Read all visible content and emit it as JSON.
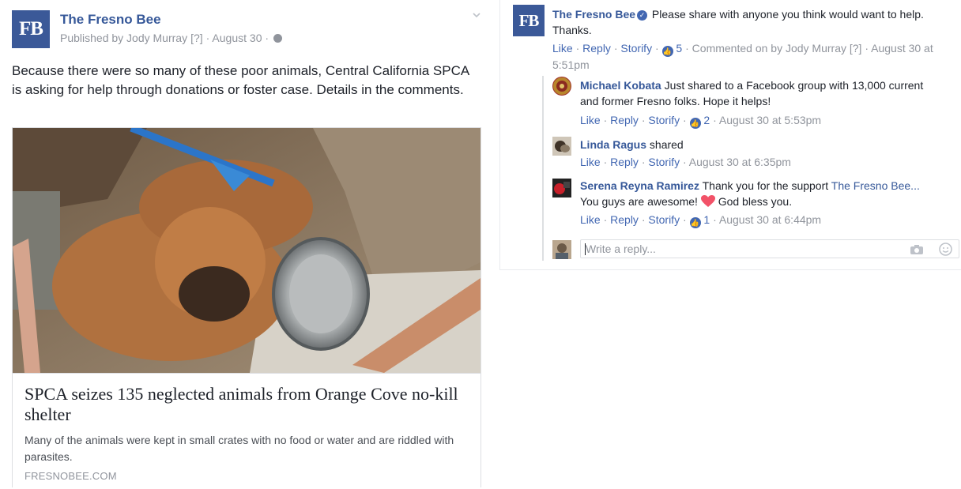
{
  "post": {
    "page_logo": "FB",
    "page_name": "The Fresno Bee",
    "published_by": "Published by Jody Murray",
    "help_marker": "[?]",
    "date": "· August 30 ·",
    "text": "Because there were so many of these poor animals, Central California SPCA is asking for help through donations or foster case. Details in the comments.",
    "link_card": {
      "title": "SPCA seizes 135 neglected animals from Orange Cove no-kill shelter",
      "description": "Many of the animals were kept in small crates with no food or water and are riddled with parasites.",
      "domain": "FRESNOBEE.COM"
    }
  },
  "comments": {
    "main": {
      "logo": "FB",
      "author": "The Fresno Bee",
      "text_line1": "Please share with anyone you think would want to help.",
      "text_line2": "Thanks.",
      "like": "Like",
      "reply": "Reply",
      "storify": "Storify",
      "likes": "5",
      "commented_on_by": "Commented on by Jody Murray",
      "help_marker": "[?]",
      "date_part1": "· August 30 at",
      "date_part2": "5:51pm"
    },
    "replies": [
      {
        "author": "Michael Kobata",
        "text_line1": "Just shared to a Facebook group with 13,000 current",
        "text_line2": "and former Fresno folks. Hope it helps!",
        "like": "Like",
        "reply": "Reply",
        "storify": "Storify",
        "likes": "2",
        "date": "· August 30 at 5:53pm"
      },
      {
        "author": "Linda Ragus",
        "text": "shared",
        "like": "Like",
        "reply": "Reply",
        "storify": "Storify",
        "date": "· August 30 at 6:35pm"
      },
      {
        "author": "Serena Reyna Ramirez",
        "text_line1": "Thank you for the support",
        "mention": "The Fresno Bee...",
        "text_line2a": "You guys are awesome!",
        "text_line2b": "God bless you.",
        "like": "Like",
        "reply": "Reply",
        "storify": "Storify",
        "likes": "1",
        "date": "· August 30 at 6:44pm"
      }
    ],
    "reply_box": {
      "placeholder": "Write a reply..."
    }
  },
  "colors": {
    "brand": "#3b5998",
    "link": "#365899",
    "action_link": "#4267b2",
    "meta_gray": "#90949c",
    "heart": "#f25268"
  },
  "icons": [
    "verified-badge-icon",
    "globe-icon",
    "chevron-down-icon",
    "like-thumb-icon",
    "heart-emoji-icon",
    "camera-icon",
    "smiley-icon"
  ]
}
